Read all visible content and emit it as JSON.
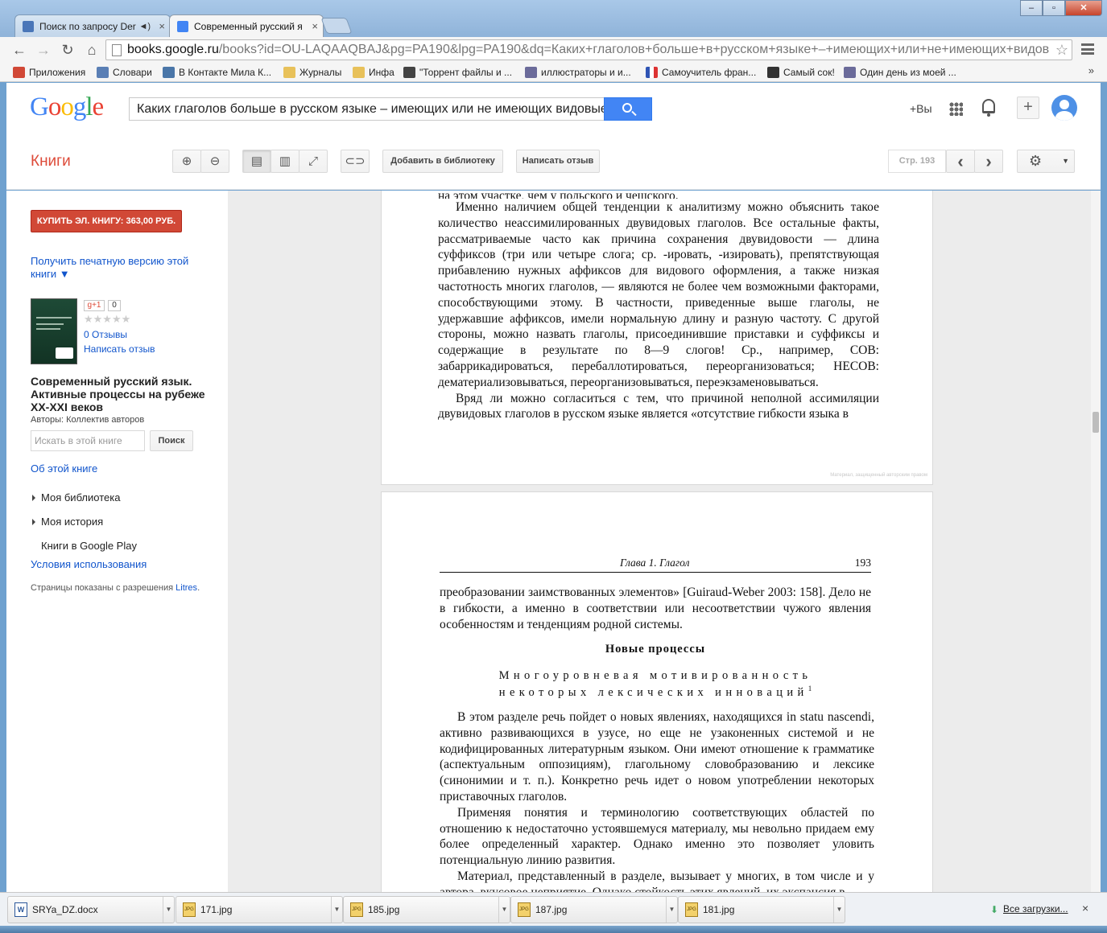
{
  "browser": {
    "tabs": [
      {
        "title": "Поиск по запросу Der",
        "active": false
      },
      {
        "title": "Современный русский я",
        "active": true
      }
    ],
    "url_domain": "books.google.ru",
    "url_path": "/books?id=OU-LAQAAQBAJ&pg=PA190&lpg=PA190&dq=Каких+глаголов+больше+в+русском+языке+–+имеющих+или+не+имеющих+видов",
    "window_buttons": [
      "–",
      "▫",
      "✕"
    ],
    "nav": {
      "back": "←",
      "forward": "→",
      "reload": "↻",
      "home": "⌂"
    }
  },
  "bookmarks": [
    {
      "label": "Приложения",
      "icon": "apps-icon",
      "color": "#d14836"
    },
    {
      "label": "Словари",
      "icon": "dictionary-icon",
      "color": "#5a7fb5"
    },
    {
      "label": "В Контакте Мила К...",
      "icon": "vk-icon",
      "color": "#4a76a8"
    },
    {
      "label": "Журналы",
      "icon": "folder-icon",
      "color": "#e8c15a"
    },
    {
      "label": "Инфа",
      "icon": "folder-icon",
      "color": "#e8c15a"
    },
    {
      "label": "\"Торрент файлы и ...",
      "icon": "film-icon",
      "color": "#444444"
    },
    {
      "label": "иллюстраторы и и...",
      "icon": "clip-icon",
      "color": "#6b6b9a"
    },
    {
      "label": "Самоучитель фран...",
      "icon": "flag-icon",
      "color": "#2f54b4"
    },
    {
      "label": "Самый сок!",
      "icon": "spy-icon",
      "color": "#333333"
    },
    {
      "label": "Один день из моей ...",
      "icon": "clip-icon",
      "color": "#6b6b9a"
    }
  ],
  "bookmarks_more": "»",
  "google": {
    "logo": "Google",
    "search_value": "Каких глаголов больше в русском языке – имеющих или не имеющих видовые п",
    "plus_you": "+Вы",
    "share": "+"
  },
  "books_header": {
    "title": "Книги",
    "add_to_library": "Добавить в библиотеку",
    "write_review": "Написать отзыв",
    "page_label": "Стр. 193",
    "prev": "‹",
    "next": "›"
  },
  "sidebar": {
    "buy_button": "КУПИТЬ ЭЛ. КНИГУ: 363,00 РУБ.",
    "print_version": "Получить печатную версию этой книги ▼",
    "gplus": "g+1",
    "gplus_count": "0",
    "stars": "★★★★★",
    "reviews": "0 Отзывы",
    "write_review": "Написать отзыв",
    "book_title": "Современный русский язык. Активные процессы на рубеже XX-XXI веков",
    "authors": "Авторы: Коллектив авторов",
    "search_placeholder": "Искать в этой книге",
    "search_button": "Поиск",
    "about": "Об этой книге",
    "my_library": "Моя библиотека",
    "my_history": "Моя история",
    "play": "Книги в Google Play",
    "terms": "Условия использования",
    "permission_prefix": "Страницы показаны с разрешения ",
    "permission_link": "Litres",
    "permission_suffix": "."
  },
  "page1": {
    "cut_line": "на этом участке, чем у польского и чешского.",
    "paragraphs": [
      "Именно наличием общей тенденции к аналитизму можно объяснить такое количество неассимилированных двувидовых глаголов. Все остальные факты, рассматриваемые часто как причина сохранения двувидовости — длина суффиксов (три или четыре слога; ср. -ировать, -изировать), препятствующая прибавлению нужных аффиксов для видового оформления, а также низкая частотность многих глаголов, — являются не более чем возможными факторами, способствующими этому. В частности, приведенные выше глаголы, не удержавшие аффиксов, имели нормальную длину и разную частоту. С другой стороны, можно назвать глаголы, присоединившие приставки и суффиксы и содержащие в результате по 8—9 слогов! Ср., например, СОВ: забаррикадироваться, перебаллотироваться, переорганизоваться; НЕСОВ: дематериализовываться, переорганизовываться, переэкзаменовываться.",
      "Вряд ли можно согласиться с тем, что причиной неполной ассимиляции двувидовых глаголов в русском языке является «отсутствие гибкости языка в"
    ],
    "watermark": "Материал, защищенный авторским правом"
  },
  "page2": {
    "running_head": "Глава 1. Глагол",
    "page_number": "193",
    "intro": "преобразовании заимствованных элементов» [Guiraud-Weber 2003: 158]. Дело не в гибкости, а именно в соответствии или несоответствии чужого явления особенностям и тенденциям родной системы.",
    "section_title": "Новые процессы",
    "subtitle_line1": "Многоуровневая мотивированность",
    "subtitle_line2": "некоторых лексических инноваций",
    "footnote_mark": "1",
    "paragraphs": [
      "В этом разделе речь пойдет о новых явлениях, находящихся in statu nascendi, активно развивающихся в узусе, но еще не узаконенных системой и не кодифицированных литературным языком. Они имеют отношение к грамматике (аспектуальным оппозициям), глагольному словобразованию и лексике (синонимии и т. п.). Конкретно речь идет о новом употреблении некоторых приставочных глаголов.",
      "Применяя понятия и терминологию соответствующих областей по отношению к недостаточно устоявшемуся материалу, мы невольно придаем ему более определенный характер. Однако именно это позволяет уловить потенциальную линию развития.",
      "Материал, представленный в разделе, вызывает у многих, в том числе и у автора, вкусовое неприятие. Однако стойкость этих явлений, их экспансия в"
    ]
  },
  "downloads": [
    {
      "name": "SRYa_DZ.docx",
      "icon": "word-doc-icon"
    },
    {
      "name": "171.jpg",
      "icon": "jpg-file-icon"
    },
    {
      "name": "185.jpg",
      "icon": "jpg-file-icon"
    },
    {
      "name": "187.jpg",
      "icon": "jpg-file-icon"
    },
    {
      "name": "181.jpg",
      "icon": "jpg-file-icon"
    }
  ],
  "all_downloads": "Все загрузки...",
  "downloads_close": "×"
}
